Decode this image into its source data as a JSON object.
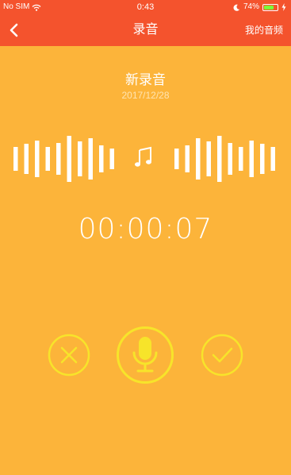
{
  "status": {
    "carrier": "No SIM",
    "time": "0:43",
    "battery_pct": "74%",
    "battery_level": 0.74
  },
  "nav": {
    "title": "录音",
    "right_link": "我的音频"
  },
  "recording": {
    "name": "新录音",
    "date": "2017/12/28",
    "elapsed": "00:00:07"
  },
  "colors": {
    "background": "#FCB43A",
    "header": "#F4532D",
    "control": "#F7E42A"
  },
  "icons": [
    "wifi-icon",
    "moon-icon",
    "battery-icon",
    "charging-icon",
    "back-icon",
    "music-note-icon",
    "cancel-icon",
    "microphone-icon",
    "confirm-icon"
  ]
}
